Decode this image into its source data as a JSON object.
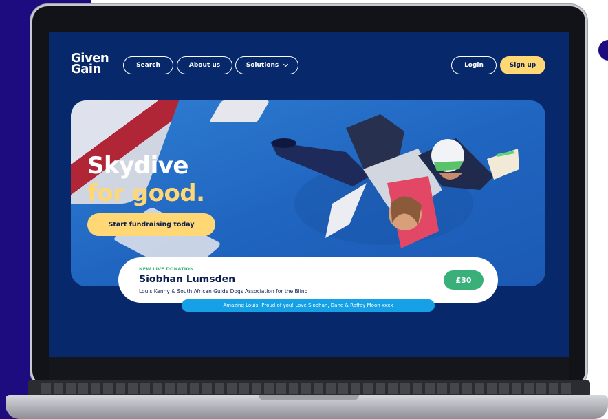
{
  "brand": {
    "logo_line1": "Given",
    "logo_line2": "Gain"
  },
  "nav": {
    "search_label": "Search",
    "about_label": "About us",
    "solutions_label": "Solutions",
    "login_label": "Login",
    "signup_label": "Sign up"
  },
  "hero": {
    "title_line1": "Skydive",
    "title_line2": "for good.",
    "cta_label": "Start fundraising today"
  },
  "donation": {
    "kicker": "NEW LIVE DONATION",
    "donor_name": "Siobhan Lumsden",
    "fundraiser": "Louis Kenny",
    "connector": " & ",
    "charity": "South African Guide Dogs Association for the Blind",
    "amount": "£30",
    "message": "Amazing Louis! Proud of you! Love Siobhan, Dane & Raffey Moon xxxx"
  },
  "colors": {
    "page_navy": "#1c0c80",
    "screen_bg": "#07296b",
    "accent_yellow": "#ffd774",
    "donation_green": "#39b07a",
    "message_blue": "#16a0e6"
  }
}
